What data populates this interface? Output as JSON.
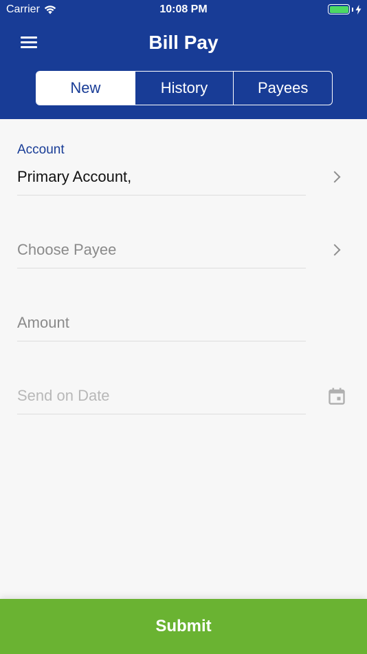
{
  "status_bar": {
    "carrier": "Carrier",
    "time": "10:08 PM",
    "battery_level": 1.0
  },
  "header": {
    "title": "Bill Pay",
    "menu_icon": "hamburger-menu-icon",
    "tabs": [
      {
        "label": "New",
        "active": true
      },
      {
        "label": "History",
        "active": false
      },
      {
        "label": "Payees",
        "active": false
      }
    ]
  },
  "form": {
    "account": {
      "label": "Account",
      "value": "Primary Account,"
    },
    "payee": {
      "placeholder": "Choose Payee"
    },
    "amount": {
      "placeholder": "Amount"
    },
    "send_date": {
      "placeholder": "Send on Date",
      "icon": "calendar-icon"
    }
  },
  "footer": {
    "submit_label": "Submit"
  },
  "colors": {
    "primary": "#183c96",
    "submit": "#6ab332",
    "battery": "#4cd964"
  }
}
